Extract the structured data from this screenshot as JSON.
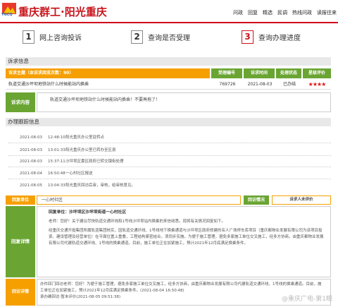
{
  "header": {
    "logo_text": "YGCQ",
    "site_title": "重庆群工·阳光重庆",
    "nav": [
      "问政",
      "回复",
      "精选",
      "民调",
      "热线问政",
      "读报往来"
    ]
  },
  "steps": [
    {
      "num": "1",
      "label": "网上咨询投诉"
    },
    {
      "num": "2",
      "label": "查询是否受理"
    },
    {
      "num": "3",
      "label": "查询办理进度"
    }
  ],
  "petition": {
    "section_title": "诉求信息",
    "headers": [
      "诉求主题（本诉求阅览次数：90）",
      "受理编号",
      "诉求时间",
      "处理状态",
      "星级评价"
    ],
    "row": {
      "subject": "轨道交通沙坪坝地铁站什么时候能站内换乘",
      "id": "769726",
      "date": "2021-08-03",
      "status": "已办结",
      "stars": "★★★★"
    },
    "content_label": "诉求内容",
    "content_text": "轨道交通沙坪坝地铁站什么时候能站内换乘！不要再拖了！"
  },
  "tracking": {
    "section_title": "办理跟踪信息",
    "items": [
      {
        "date": "2021-08-03",
        "time": "12:48:10",
        "text": "阳光重庆办公室驻转点"
      },
      {
        "date": "2021-08-03",
        "time": "13:01:33",
        "text": "阳光重庆办公室已转办至区县"
      },
      {
        "date": "2021-08-03",
        "time": "15:37:11",
        "text": "沙坪坝区委区政府已转交镇街处理"
      },
      {
        "date": "2021-08-04",
        "time": "16:50:48",
        "text": "一心村社区报送"
      },
      {
        "date": "2021-08-05",
        "time": "13:04:33",
        "text": "阳光重庆回访后审，审核，给审核意见。"
      }
    ]
  },
  "reply": {
    "unit_label": "回复单位",
    "unit_name": "一心村社区",
    "visit_label": "回访情况",
    "visit_status": "诉求人未评价",
    "detail_label": "回复详情",
    "reply_unit": "回复单位：沙坪坝区沙坪坝街道一心村社区",
    "paragraphs": [
      "老师：您好！关于建议尽快轨道交通环线和1号线沙坪坝站内换乘的来信收悉。现将有关情况回复如下。",
      "经重庆交通开投集团所属轨道集团核实，因轨道交通环线、1号线地下换乘通道与沙坪坝区政府修建的名人广场停车库项目（重庆都物业发展有限公司为该项目投资、建设管理及经营单位）在平面位置上重叠，工程结构紧密结合，须同步实施。为便于施工管理，避免多家施工单位交叉施工，经多方协商，由重庆都物业发展有限公司代建轨道交通环线、1号线的换乘通道。目前，施工单位正在加紧施工，预计2021年12月底满足换乘条件。"
    ],
    "visit_detail_label": "回访详情",
    "visit_detail_text": "办件回门回访老师：您好！为便于施工管理，避免多家施工单位交叉施工，经多方协商，由重庆都物业发展有限公司代建轨道交通环线、1号线的换乘通道。目前，施工单位正在加紧施工，预计2021年12月底满足换乘条件。(2021-08-04 16:50:48)",
    "visit_footer": "承办确回访:暂未评价(2021-08-05 09:51:38)"
  },
  "watermark": "@重庆广电-第1眼"
}
